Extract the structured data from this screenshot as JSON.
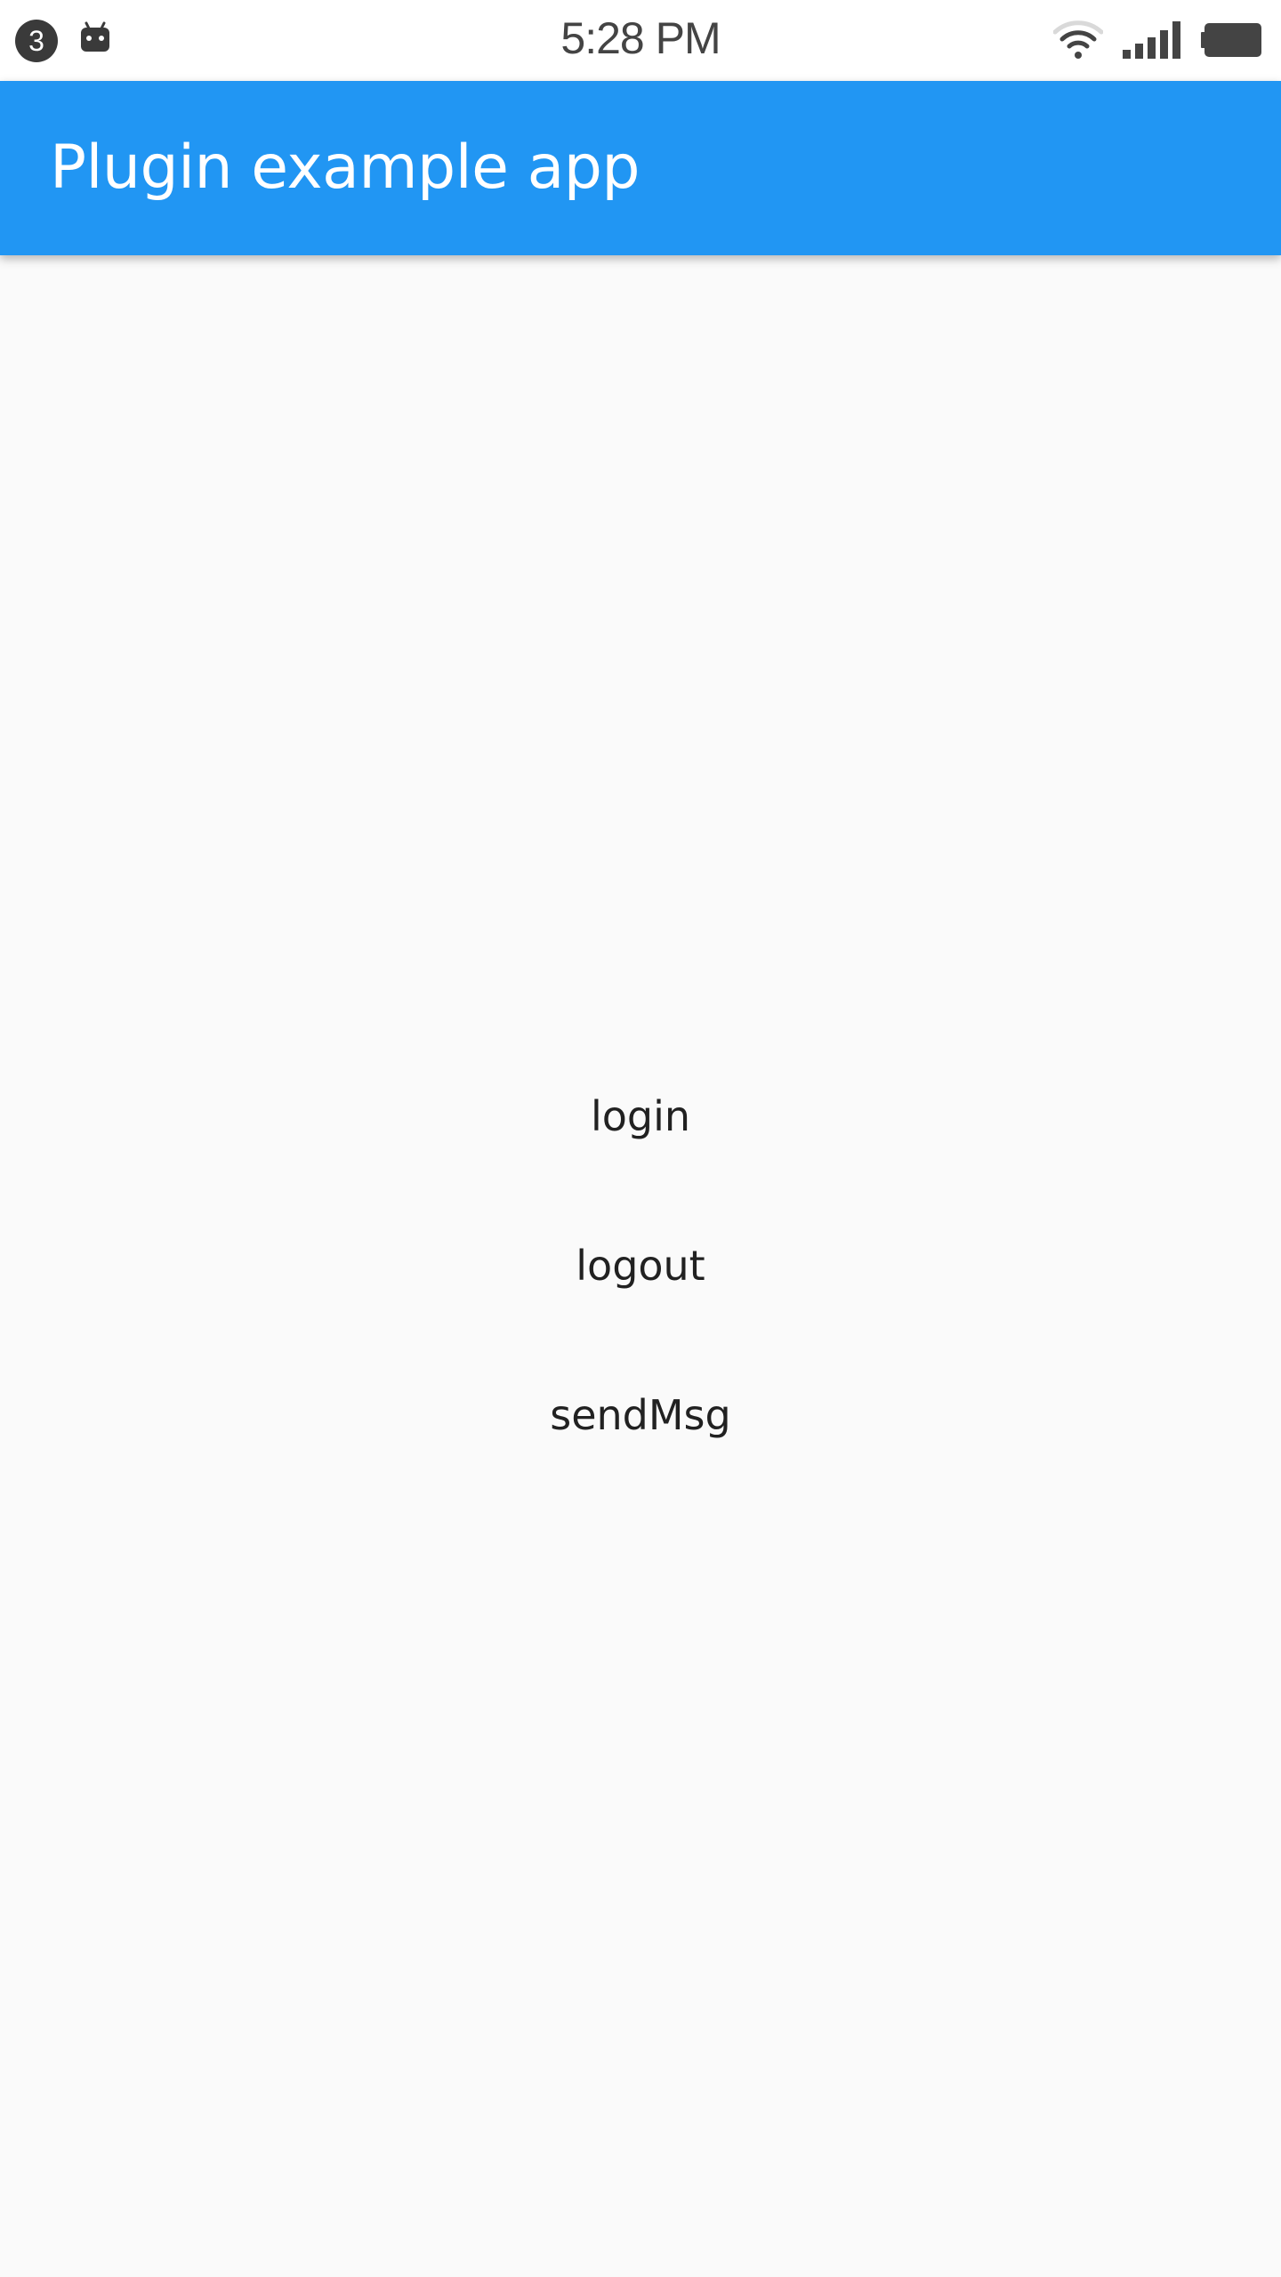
{
  "status_bar": {
    "notification_count": "3",
    "time": "5:28 PM",
    "icons": [
      "notification-badge",
      "android-icon",
      "wifi-icon",
      "signal-icon",
      "battery-icon"
    ]
  },
  "app_bar": {
    "title": "Plugin example app",
    "color": "#2196f3"
  },
  "actions": {
    "login": "login",
    "logout": "logout",
    "send": "sendMsg"
  },
  "colors": {
    "background": "#fafafa",
    "text": "#212121",
    "status_icons": "#444444"
  }
}
